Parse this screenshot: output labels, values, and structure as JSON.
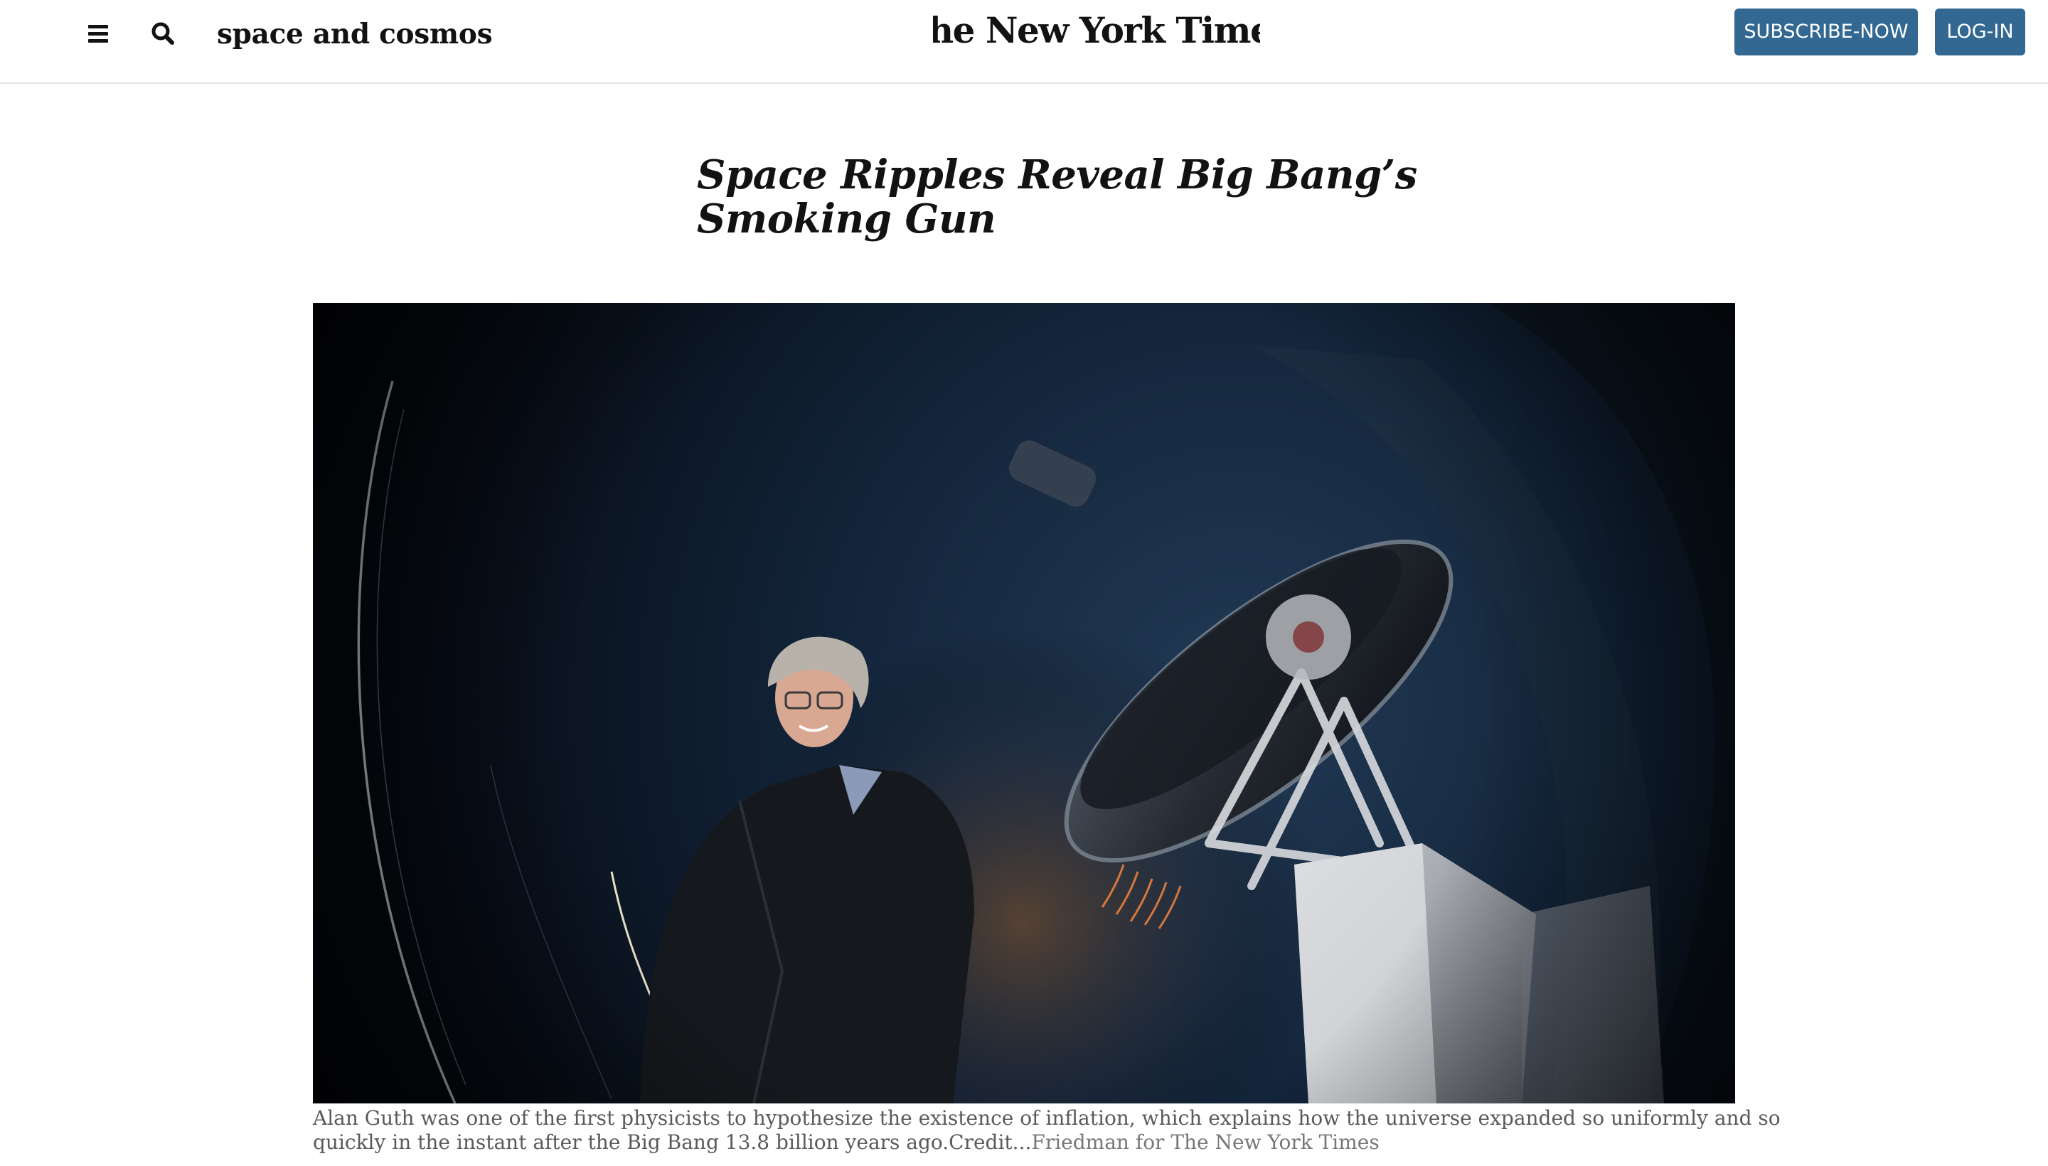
{
  "header": {
    "section_label": "space and cosmos",
    "logo_text": "The New York Times",
    "subscribe_label": "SUBSCRIBE-NOW",
    "login_label": "LOG-IN",
    "menu_icon": "menu-icon",
    "search_icon": "search-icon"
  },
  "article": {
    "headline_line1": "Space Ripples Reveal Big Bang’s",
    "headline_line2": "Smoking Gun",
    "photo_subject": "photo of a man in a dark jacket standing in front of a large telescope at night",
    "caption": {
      "line1": "Alan Guth was one of the first physicists to hypothesize the existence of inflation, which explains how the universe expanded so uniformly and so",
      "line2_text": "quickly in the instant after the Big Bang 13.8 billion years ago.",
      "credit_label": "Credit...",
      "credit_name": "Friedman for The New York Times"
    }
  },
  "colors": {
    "brand_blue": "#326891",
    "text": "#121212",
    "caption_text": "#5a5a5a",
    "divider": "#e2e2e2"
  }
}
